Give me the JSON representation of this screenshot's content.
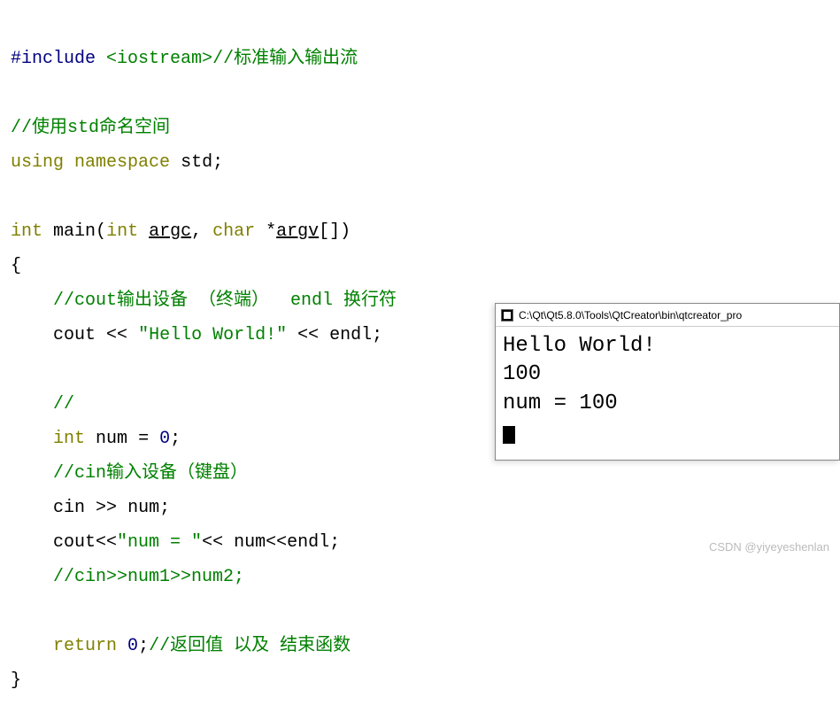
{
  "code": {
    "include_directive": "#include",
    "include_header": "<iostream>",
    "include_comment": "//标准输入输出流",
    "ns_comment": "//使用std命名空间",
    "using_kw": "using",
    "namespace_kw": "namespace",
    "std_ident": "std",
    "int_kw": "int",
    "main_fn": "main",
    "char_kw": "char",
    "argc": "argc",
    "argv": "argv",
    "lbrace": "{",
    "rbrace": "}",
    "cout_comment": "//cout输出设备 （终端）  endl 换行符",
    "cout": "cout",
    "lshift": "<<",
    "hello_str": "\"Hello World!\"",
    "endl": "endl",
    "blank_comment": "//",
    "num_ident": "num",
    "eq": "=",
    "zero": "0",
    "cin_comment": "//cin输入设备（键盘）",
    "cin": "cin",
    "rshift": ">>",
    "numeq_str": "\"num = \"",
    "cin_multi_comment": "//cin>>num1>>num2;",
    "return_kw": "return",
    "return_comment": "//返回值 以及 结束函数"
  },
  "terminal": {
    "title": "C:\\Qt\\Qt5.8.0\\Tools\\QtCreator\\bin\\qtcreator_pro",
    "line1": "Hello World!",
    "line2": "100",
    "line3": "num = 100"
  },
  "watermark": "CSDN @yiyeyeshenlan"
}
